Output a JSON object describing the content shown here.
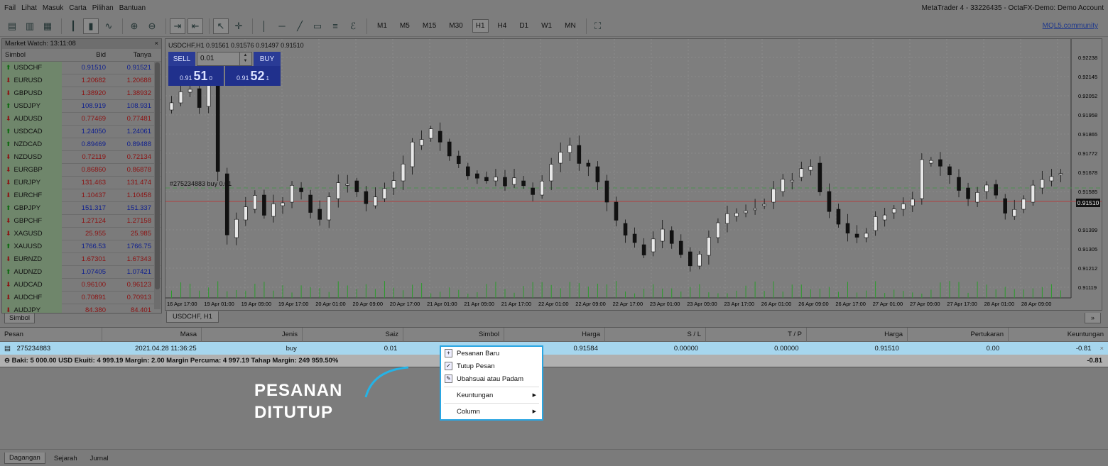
{
  "menu": [
    "Fail",
    "Lihat",
    "Masuk",
    "Carta",
    "Pilihan",
    "Bantuan"
  ],
  "window_title": "MetaTrader 4 - 33226435 - OctaFX-Demo: Demo Account",
  "timeframes": [
    "M1",
    "M5",
    "M15",
    "M30",
    "H1",
    "H4",
    "D1",
    "W1",
    "MN"
  ],
  "active_timeframe": "H1",
  "mql": "MQL5.community",
  "market_watch": {
    "title": "Market Watch: 13:11:08",
    "cols": [
      "Simbol",
      "Bid",
      "Tanya"
    ],
    "rows": [
      {
        "s": "USDCHF",
        "b": "0.91510",
        "a": "0.91521",
        "d": "up",
        "c": "bl"
      },
      {
        "s": "EURUSD",
        "b": "1.20682",
        "a": "1.20688",
        "d": "dn",
        "c": "rd"
      },
      {
        "s": "GBPUSD",
        "b": "1.38920",
        "a": "1.38932",
        "d": "dn",
        "c": "rd"
      },
      {
        "s": "USDJPY",
        "b": "108.919",
        "a": "108.931",
        "d": "up",
        "c": "bl"
      },
      {
        "s": "AUDUSD",
        "b": "0.77469",
        "a": "0.77481",
        "d": "dn",
        "c": "rd"
      },
      {
        "s": "USDCAD",
        "b": "1.24050",
        "a": "1.24061",
        "d": "up",
        "c": "bl"
      },
      {
        "s": "NZDCAD",
        "b": "0.89469",
        "a": "0.89488",
        "d": "up",
        "c": "bl"
      },
      {
        "s": "NZDUSD",
        "b": "0.72119",
        "a": "0.72134",
        "d": "dn",
        "c": "rd"
      },
      {
        "s": "EURGBP",
        "b": "0.86860",
        "a": "0.86878",
        "d": "dn",
        "c": "rd"
      },
      {
        "s": "EURJPY",
        "b": "131.463",
        "a": "131.474",
        "d": "dn",
        "c": "rd"
      },
      {
        "s": "EURCHF",
        "b": "1.10437",
        "a": "1.10458",
        "d": "dn",
        "c": "rd"
      },
      {
        "s": "GBPJPY",
        "b": "151.317",
        "a": "151.337",
        "d": "up",
        "c": "bl"
      },
      {
        "s": "GBPCHF",
        "b": "1.27124",
        "a": "1.27158",
        "d": "dn",
        "c": "rd"
      },
      {
        "s": "XAGUSD",
        "b": "25.955",
        "a": "25.985",
        "d": "dn",
        "c": "rd"
      },
      {
        "s": "XAUUSD",
        "b": "1766.53",
        "a": "1766.75",
        "d": "up",
        "c": "bl"
      },
      {
        "s": "EURNZD",
        "b": "1.67301",
        "a": "1.67343",
        "d": "dn",
        "c": "rd"
      },
      {
        "s": "AUDNZD",
        "b": "1.07405",
        "a": "1.07421",
        "d": "up",
        "c": "bl"
      },
      {
        "s": "AUDCAD",
        "b": "0.96100",
        "a": "0.96123",
        "d": "dn",
        "c": "rd"
      },
      {
        "s": "AUDCHF",
        "b": "0.70891",
        "a": "0.70913",
        "d": "dn",
        "c": "rd"
      },
      {
        "s": "AUDJPY",
        "b": "84.380",
        "a": "84.401",
        "d": "dn",
        "c": "rd"
      }
    ],
    "tab": "Simbol"
  },
  "chart": {
    "header": "USDCHF,H1  0.91561 0.91576 0.91497 0.91510",
    "sell": "SELL",
    "buy": "BUY",
    "lot": "0.01",
    "sell_small": "0.91",
    "sell_big": "51",
    "sell_sup": "0",
    "buy_small": "0.91",
    "buy_big": "52",
    "buy_sup": "1",
    "order_label": "#275234883 buy 0.01",
    "price_tag": "0.91510",
    "tab": "USDCHF, H1",
    "price_labels": [
      "0.92238",
      "0.92145",
      "0.92052",
      "0.91958",
      "0.91865",
      "0.91772",
      "0.91678",
      "0.91585",
      "0.91510",
      "0.91399",
      "0.91305",
      "0.91212",
      "0.91119"
    ],
    "time_labels": [
      "16 Apr 17:00",
      "19 Apr 01:00",
      "19 Apr 09:00",
      "19 Apr 17:00",
      "20 Apr 01:00",
      "20 Apr 09:00",
      "20 Apr 17:00",
      "21 Apr 01:00",
      "21 Apr 09:00",
      "21 Apr 17:00",
      "22 Apr 01:00",
      "22 Apr 09:00",
      "22 Apr 17:00",
      "23 Apr 01:00",
      "23 Apr 09:00",
      "23 Apr 17:00",
      "26 Apr 01:00",
      "26 Apr 09:00",
      "26 Apr 17:00",
      "27 Apr 01:00",
      "27 Apr 09:00",
      "27 Apr 17:00",
      "28 Apr 01:00",
      "28 Apr 09:00"
    ]
  },
  "terminal": {
    "cols": [
      "Pesan",
      "Masa",
      "Jenis",
      "Saiz",
      "Simbol",
      "Harga",
      "S / L",
      "T / P",
      "Harga",
      "Pertukaran",
      "Keuntungan"
    ],
    "order": {
      "id": "275234883",
      "time": "2021.04.28 11:36:25",
      "type": "buy",
      "size": "0.01",
      "price": "0.91584",
      "sl": "0.00000",
      "tp": "0.00000",
      "cur": "0.91510",
      "swap": "0.00",
      "profit": "-0.81"
    },
    "balance": "Baki: 5 000.00 USD  Ekuiti: 4 999.19  Margin: 2.00  Margin Percuma: 4 997.19  Tahap Margin: 249 959.50%",
    "balance_profit": "-0.81",
    "tabs": [
      "Dagangan",
      "Sejarah",
      "Jurnal"
    ]
  },
  "context_menu": {
    "items": [
      "Pesanan Baru",
      "Tutup Pesan",
      "Ubahsuai atau Padam",
      "Keuntungan",
      "Column"
    ]
  },
  "caption": {
    "line1": "PESANAN",
    "line2": "DITUTUP"
  }
}
